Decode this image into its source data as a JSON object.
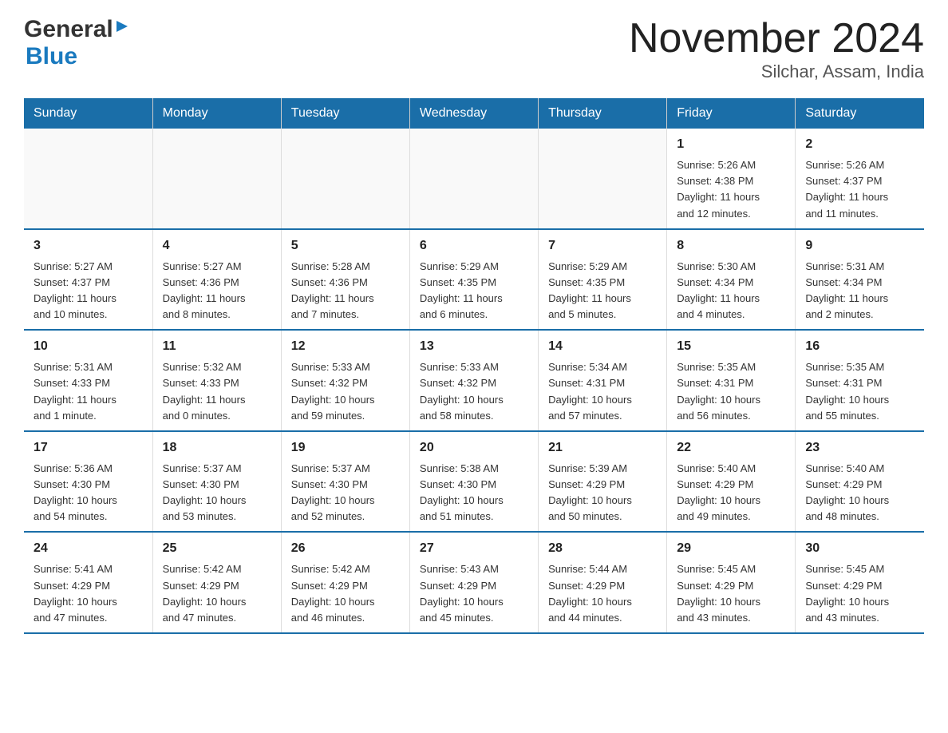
{
  "header": {
    "title": "November 2024",
    "subtitle": "Silchar, Assam, India",
    "logo_general": "General",
    "logo_blue": "Blue"
  },
  "weekdays": [
    "Sunday",
    "Monday",
    "Tuesday",
    "Wednesday",
    "Thursday",
    "Friday",
    "Saturday"
  ],
  "weeks": [
    [
      {
        "day": "",
        "info": ""
      },
      {
        "day": "",
        "info": ""
      },
      {
        "day": "",
        "info": ""
      },
      {
        "day": "",
        "info": ""
      },
      {
        "day": "",
        "info": ""
      },
      {
        "day": "1",
        "info": "Sunrise: 5:26 AM\nSunset: 4:38 PM\nDaylight: 11 hours\nand 12 minutes."
      },
      {
        "day": "2",
        "info": "Sunrise: 5:26 AM\nSunset: 4:37 PM\nDaylight: 11 hours\nand 11 minutes."
      }
    ],
    [
      {
        "day": "3",
        "info": "Sunrise: 5:27 AM\nSunset: 4:37 PM\nDaylight: 11 hours\nand 10 minutes."
      },
      {
        "day": "4",
        "info": "Sunrise: 5:27 AM\nSunset: 4:36 PM\nDaylight: 11 hours\nand 8 minutes."
      },
      {
        "day": "5",
        "info": "Sunrise: 5:28 AM\nSunset: 4:36 PM\nDaylight: 11 hours\nand 7 minutes."
      },
      {
        "day": "6",
        "info": "Sunrise: 5:29 AM\nSunset: 4:35 PM\nDaylight: 11 hours\nand 6 minutes."
      },
      {
        "day": "7",
        "info": "Sunrise: 5:29 AM\nSunset: 4:35 PM\nDaylight: 11 hours\nand 5 minutes."
      },
      {
        "day": "8",
        "info": "Sunrise: 5:30 AM\nSunset: 4:34 PM\nDaylight: 11 hours\nand 4 minutes."
      },
      {
        "day": "9",
        "info": "Sunrise: 5:31 AM\nSunset: 4:34 PM\nDaylight: 11 hours\nand 2 minutes."
      }
    ],
    [
      {
        "day": "10",
        "info": "Sunrise: 5:31 AM\nSunset: 4:33 PM\nDaylight: 11 hours\nand 1 minute."
      },
      {
        "day": "11",
        "info": "Sunrise: 5:32 AM\nSunset: 4:33 PM\nDaylight: 11 hours\nand 0 minutes."
      },
      {
        "day": "12",
        "info": "Sunrise: 5:33 AM\nSunset: 4:32 PM\nDaylight: 10 hours\nand 59 minutes."
      },
      {
        "day": "13",
        "info": "Sunrise: 5:33 AM\nSunset: 4:32 PM\nDaylight: 10 hours\nand 58 minutes."
      },
      {
        "day": "14",
        "info": "Sunrise: 5:34 AM\nSunset: 4:31 PM\nDaylight: 10 hours\nand 57 minutes."
      },
      {
        "day": "15",
        "info": "Sunrise: 5:35 AM\nSunset: 4:31 PM\nDaylight: 10 hours\nand 56 minutes."
      },
      {
        "day": "16",
        "info": "Sunrise: 5:35 AM\nSunset: 4:31 PM\nDaylight: 10 hours\nand 55 minutes."
      }
    ],
    [
      {
        "day": "17",
        "info": "Sunrise: 5:36 AM\nSunset: 4:30 PM\nDaylight: 10 hours\nand 54 minutes."
      },
      {
        "day": "18",
        "info": "Sunrise: 5:37 AM\nSunset: 4:30 PM\nDaylight: 10 hours\nand 53 minutes."
      },
      {
        "day": "19",
        "info": "Sunrise: 5:37 AM\nSunset: 4:30 PM\nDaylight: 10 hours\nand 52 minutes."
      },
      {
        "day": "20",
        "info": "Sunrise: 5:38 AM\nSunset: 4:30 PM\nDaylight: 10 hours\nand 51 minutes."
      },
      {
        "day": "21",
        "info": "Sunrise: 5:39 AM\nSunset: 4:29 PM\nDaylight: 10 hours\nand 50 minutes."
      },
      {
        "day": "22",
        "info": "Sunrise: 5:40 AM\nSunset: 4:29 PM\nDaylight: 10 hours\nand 49 minutes."
      },
      {
        "day": "23",
        "info": "Sunrise: 5:40 AM\nSunset: 4:29 PM\nDaylight: 10 hours\nand 48 minutes."
      }
    ],
    [
      {
        "day": "24",
        "info": "Sunrise: 5:41 AM\nSunset: 4:29 PM\nDaylight: 10 hours\nand 47 minutes."
      },
      {
        "day": "25",
        "info": "Sunrise: 5:42 AM\nSunset: 4:29 PM\nDaylight: 10 hours\nand 47 minutes."
      },
      {
        "day": "26",
        "info": "Sunrise: 5:42 AM\nSunset: 4:29 PM\nDaylight: 10 hours\nand 46 minutes."
      },
      {
        "day": "27",
        "info": "Sunrise: 5:43 AM\nSunset: 4:29 PM\nDaylight: 10 hours\nand 45 minutes."
      },
      {
        "day": "28",
        "info": "Sunrise: 5:44 AM\nSunset: 4:29 PM\nDaylight: 10 hours\nand 44 minutes."
      },
      {
        "day": "29",
        "info": "Sunrise: 5:45 AM\nSunset: 4:29 PM\nDaylight: 10 hours\nand 43 minutes."
      },
      {
        "day": "30",
        "info": "Sunrise: 5:45 AM\nSunset: 4:29 PM\nDaylight: 10 hours\nand 43 minutes."
      }
    ]
  ]
}
